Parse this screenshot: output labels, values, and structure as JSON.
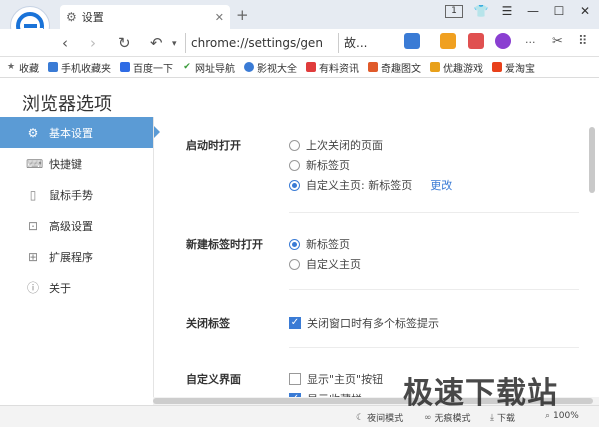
{
  "tab": {
    "title": "设置"
  },
  "titlebar": {
    "tab_count": "1"
  },
  "address": {
    "url": "chrome://settings/gen",
    "short_site": "故..."
  },
  "bookmarks": [
    {
      "label": "收藏",
      "icon": "star-icon",
      "color": "#666666"
    },
    {
      "label": "手机收藏夹",
      "icon": "phone-icon",
      "color": "#3a7bd5"
    },
    {
      "label": "百度一下",
      "icon": "baidu-icon",
      "color": "#2f6ce5"
    },
    {
      "label": "网址导航",
      "icon": "check-icon",
      "color": "#3a9b3a"
    },
    {
      "label": "影视大全",
      "icon": "video-icon",
      "color": "#3a7bd5"
    },
    {
      "label": "有料资讯",
      "icon": "news-icon",
      "color": "#e03c3c"
    },
    {
      "label": "奇趣图文",
      "icon": "image-icon",
      "color": "#e05a2a"
    },
    {
      "label": "优趣游戏",
      "icon": "game-icon",
      "color": "#e8a01a"
    },
    {
      "label": "爱淘宝",
      "icon": "taobao-icon",
      "color": "#e8401a"
    }
  ],
  "page": {
    "title": "浏览器选项"
  },
  "sidebar": {
    "items": [
      {
        "label": "基本设置",
        "icon": "gear-icon"
      },
      {
        "label": "快捷键",
        "icon": "keyboard-icon"
      },
      {
        "label": "鼠标手势",
        "icon": "mouse-icon"
      },
      {
        "label": "高级设置",
        "icon": "advanced-icon"
      },
      {
        "label": "扩展程序",
        "icon": "extension-icon"
      },
      {
        "label": "关于",
        "icon": "info-icon"
      }
    ]
  },
  "sections": {
    "startup": {
      "label": "启动时打开",
      "options": [
        "上次关闭的页面",
        "新标签页",
        "自定义主页: 新标签页"
      ],
      "selected": 2,
      "change_link": "更改"
    },
    "newtab": {
      "label": "新建标签时打开",
      "options": [
        "新标签页",
        "自定义主页"
      ],
      "selected": 0
    },
    "closetab": {
      "label": "关闭标签",
      "checkbox": "关闭窗口时有多个标签提示",
      "checked": true
    },
    "custom": {
      "label": "自定义界面",
      "checkbox1": "显示\"主页\"按钮",
      "checkbox2": "显示收藏栏"
    }
  },
  "status": {
    "night_mode": "夜间模式",
    "no_image": "无痕模式",
    "download": "下载",
    "zoom": "100%"
  },
  "watermark": "极速下载站",
  "colors": {
    "accent": "#5b9bd5",
    "link": "#3a7bd5"
  }
}
